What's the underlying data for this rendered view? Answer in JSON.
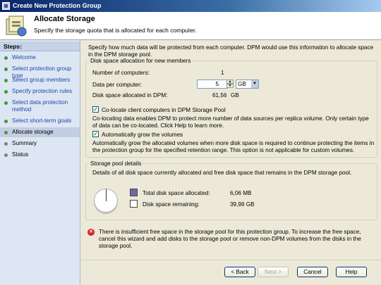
{
  "window": {
    "title": "Create New Protection Group"
  },
  "header": {
    "title": "Allocate Storage",
    "subtitle": "Specify the storage quota that is allocated for each computer."
  },
  "steps": {
    "heading": "Steps:",
    "items": [
      {
        "label": "Welcome",
        "state": "done"
      },
      {
        "label": "Select protection group type",
        "state": "done"
      },
      {
        "label": "Select group members",
        "state": "done"
      },
      {
        "label": "Specify protection rules",
        "state": "done"
      },
      {
        "label": "Select data protection method",
        "state": "done"
      },
      {
        "label": "Select short-term goals",
        "state": "done"
      },
      {
        "label": "Allocate storage",
        "state": "current"
      },
      {
        "label": "Summary",
        "state": "pending"
      },
      {
        "label": "Status",
        "state": "pending"
      }
    ]
  },
  "intro": "Specify how much data will be protected from each computer. DPM would use this information to allocate space in the DPM storage pool.",
  "disk_alloc": {
    "legend": "Disk space allocation for new members",
    "num_computers_label": "Number of computers:",
    "num_computers_value": "1",
    "data_per_computer_label": "Data per computer:",
    "data_per_computer_value": "5",
    "unit_value": "GB",
    "allocated_label": "Disk space allocated in DPM:",
    "allocated_value": "61,56",
    "allocated_unit": "GB",
    "colocate_label": "Co-locate client computers in DPM Storage Pool",
    "colocate_desc": "Co-locating data enables DPM to protect more number of data sources per replica volume. Only certain type of data can be co-located. Click Help to learn more.",
    "autogrow_label": "Automatically grow the volumes",
    "autogrow_desc": "Automatically grow the allocated volumes when more disk space is required to continue protecting the items in the protection group for the specified retention range. This option is not applicable for custom volumes."
  },
  "storage_pool": {
    "legend": "Storage pool details",
    "desc": "Details of all disk space currently allocated and free disk space that remains in the DPM storage pool.",
    "allocated_label": "Total disk space allocated:",
    "allocated_value": "6,06 MB",
    "remaining_label": "Disk space remaining:",
    "remaining_value": "39,99 GB",
    "allocated_color": "#6b6aa8",
    "remaining_color": "#ffffff"
  },
  "error": {
    "icon": "error-icon",
    "text": "There is insufficient free space in the storage pool for this protection group. To increase the free space, cancel this wizard and add disks to the storage pool or remove non-DPM volumes from the disks in the storage pool."
  },
  "footer": {
    "back": "< Back",
    "next": "Next >",
    "cancel": "Cancel",
    "help": "Help"
  }
}
